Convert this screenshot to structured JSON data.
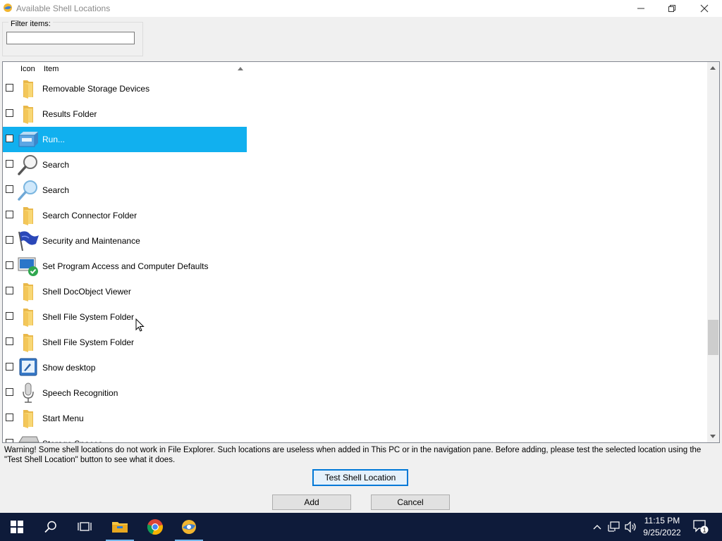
{
  "window": {
    "title": "Available Shell Locations"
  },
  "filter": {
    "label": "Filter items:",
    "value": ""
  },
  "list": {
    "columns": {
      "icon": "Icon",
      "item": "Item"
    },
    "sort": "ascending",
    "items": [
      {
        "label": "Removable Storage Devices",
        "icon": "folder-icon",
        "checked": false,
        "selected": false
      },
      {
        "label": "Results Folder",
        "icon": "folder-icon",
        "checked": false,
        "selected": false
      },
      {
        "label": "Run...",
        "icon": "run-dialog-icon",
        "checked": false,
        "selected": true
      },
      {
        "label": "Search",
        "icon": "magnifier-icon",
        "checked": false,
        "selected": false
      },
      {
        "label": "Search",
        "icon": "magnifier-light-icon",
        "checked": false,
        "selected": false
      },
      {
        "label": "Search Connector Folder",
        "icon": "folder-icon",
        "checked": false,
        "selected": false
      },
      {
        "label": "Security and Maintenance",
        "icon": "flag-icon",
        "checked": false,
        "selected": false
      },
      {
        "label": "Set Program Access and Computer Defaults",
        "icon": "program-defaults-icon",
        "checked": false,
        "selected": false
      },
      {
        "label": "Shell DocObject Viewer",
        "icon": "folder-icon",
        "checked": false,
        "selected": false
      },
      {
        "label": "Shell File System Folder",
        "icon": "folder-icon",
        "checked": false,
        "selected": false
      },
      {
        "label": "Shell File System Folder",
        "icon": "folder-icon",
        "checked": false,
        "selected": false
      },
      {
        "label": "Show desktop",
        "icon": "show-desktop-icon",
        "checked": false,
        "selected": false
      },
      {
        "label": "Speech Recognition",
        "icon": "microphone-icon",
        "checked": false,
        "selected": false
      },
      {
        "label": "Start Menu",
        "icon": "folder-icon",
        "checked": false,
        "selected": false
      },
      {
        "label": "Storage Spaces",
        "icon": "drive-icon",
        "checked": false,
        "selected": false
      }
    ]
  },
  "warning": "Warning! Some shell locations do not work in File Explorer. Such locations are useless when added in This PC or in the navigation pane. Before adding, please test the selected location using the \"Test Shell Location\" button to see what it does.",
  "buttons": {
    "test": "Test Shell Location",
    "add": "Add",
    "cancel": "Cancel"
  },
  "taskbar": {
    "apps": [
      "start-icon",
      "search-icon",
      "task-view-icon",
      "file-explorer-icon",
      "chrome-icon",
      "winaero-tweaker-icon"
    ],
    "clock": {
      "time": "11:15 PM",
      "date": "9/25/2022"
    },
    "notifications": "1"
  },
  "colors": {
    "selection": "#11b0ef",
    "taskbar": "#0e1b3a",
    "focus": "#0078d7"
  }
}
